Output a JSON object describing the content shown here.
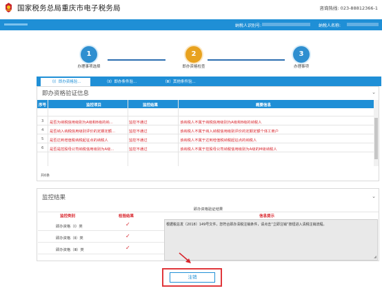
{
  "header": {
    "title": "国家税务总局重庆市电子税务局",
    "hotline": "咨询热线: 023-88812366-1"
  },
  "bluebar": {
    "taxpayer_id_label": "纳税人识别号:",
    "taxpayer_name_label": "纳税人名称:"
  },
  "steps": [
    {
      "number": "1",
      "label": "办理事项选择",
      "color": "#2f8fd0"
    },
    {
      "number": "2",
      "label": "即办资格检查",
      "color": "#e8a21f"
    },
    {
      "number": "3",
      "label": "办理事项",
      "color": "#2f8fd0"
    }
  ],
  "tabs": [
    {
      "label": "（Ⅰ）即办资格验..."
    },
    {
      "label": "（Ⅱ）即办条件验..."
    },
    {
      "label": "（Ⅲ）其他条件验..."
    }
  ],
  "verification": {
    "title": "即办资格验证信息",
    "columns": [
      "序号",
      "监控项目",
      "监控结果",
      "概要信息"
    ],
    "rows": [
      {
        "no": "3",
        "item": "是否为纳税信用级别为A级和B级的纳...",
        "result": "监控不通过",
        "summary": "该纳税人不属于纳税信用级别为A级和B级的纳税人"
      },
      {
        "no": "4",
        "item": "是否纳入纳税信用级别评价的定期定额...",
        "result": "监控不通过",
        "summary": "该纳税人不属于纳入纳税信用级别评价的定期定额个体工商户"
      },
      {
        "no": "5",
        "item": "是否达到增值税纳税起征点的纳税人",
        "result": "监控不通过",
        "summary": "该纳税人不属于达到增值税纳税起征点的纳税人"
      },
      {
        "no": "6",
        "item": "是否是控股母公司纳税信用级别为A级...",
        "result": "监控不通过",
        "summary": "该纳税人不属于控股母公司纳税信用级别为A级的M级纳税人"
      }
    ],
    "total": "共6条"
  },
  "monitor": {
    "title": "监控结果",
    "subtitle": "即办资格验证结果",
    "col_category": "监控类别",
    "col_result": "检验结果",
    "col_info": "信息提示",
    "rows": [
      {
        "label": "即办资格（Ⅰ）类",
        "check": "✓"
      },
      {
        "label": "即办资格（Ⅱ）类",
        "check": "✓"
      },
      {
        "label": "即办资格（Ⅲ）类",
        "check": "✓"
      }
    ],
    "info_text": "根据税总发〔2018〕149号文件，您符合即办清税注销条件，请点击“立即注销”按钮进入清税注销流程。"
  },
  "actions": {
    "cancel_label": "注销"
  }
}
